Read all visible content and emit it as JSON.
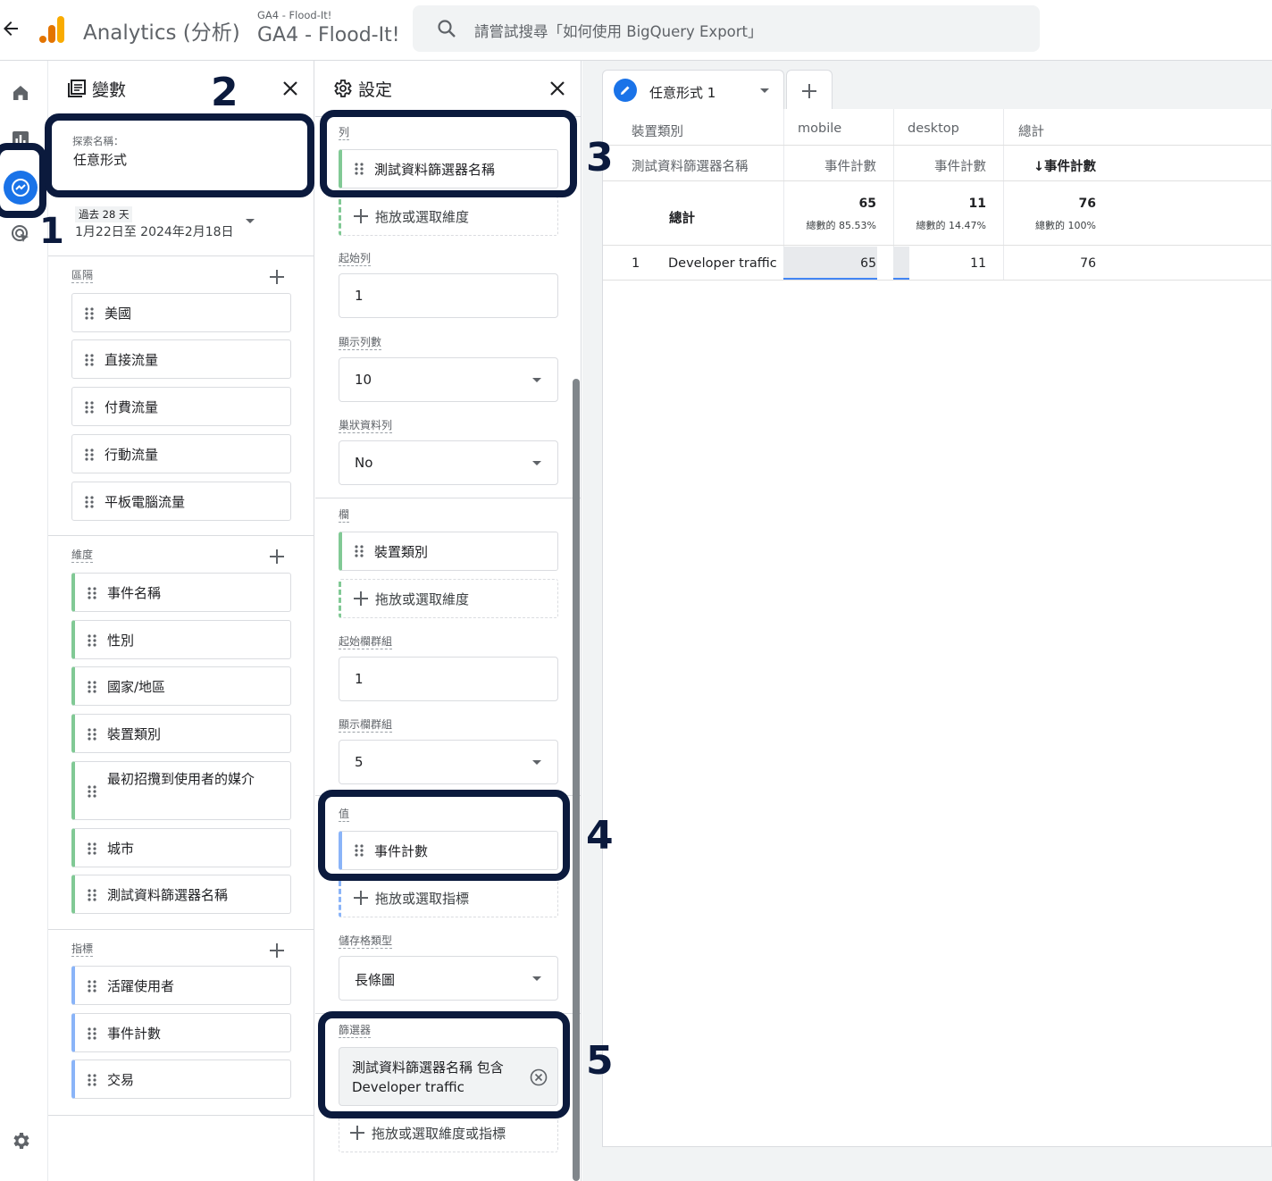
{
  "header": {
    "app_title": "Analytics (分析)",
    "property_small": "GA4 - Flood-It!",
    "property_name": "GA4 - Flood-It!",
    "search_placeholder": "請嘗試搜尋「如何使用 BigQuery Export」"
  },
  "rail": {
    "icons": [
      "home-icon",
      "reports-icon",
      "explore-icon",
      "advertising-icon",
      "settings-icon"
    ]
  },
  "variables": {
    "title": "變數",
    "exploration_name_label": "探索名稱：",
    "exploration_name": "任意形式",
    "date_preset": "過去 28 天",
    "date_range": "1月22日至 2024年2月18日",
    "segments_label": "區隔",
    "segments": [
      "美國",
      "直接流量",
      "付費流量",
      "行動流量",
      "平板電腦流量"
    ],
    "dimensions_label": "維度",
    "dimensions": [
      "事件名稱",
      "性別",
      "國家/地區",
      "裝置類別",
      "最初招攬到使用者的媒介",
      "城市",
      "測試資料篩選器名稱"
    ],
    "metrics_label": "指標",
    "metrics": [
      "活躍使用者",
      "事件計數",
      "交易"
    ]
  },
  "settings": {
    "title": "設定",
    "rows_label": "列",
    "rows_item": "測試資料篩選器名稱",
    "drop_dimension": "拖放或選取維度",
    "start_row_label": "起始列",
    "start_row": "1",
    "show_rows_label": "顯示列數",
    "show_rows": "10",
    "nested_rows_label": "巢狀資料列",
    "nested_rows": "No",
    "columns_label": "欄",
    "columns_item": "裝置類別",
    "drop_dimension_2": "拖放或選取維度",
    "start_col_group_label": "起始欄群組",
    "start_col_group": "1",
    "show_col_groups_label": "顯示欄群組",
    "show_col_groups": "5",
    "values_label": "值",
    "values_item": "事件計數",
    "drop_metric": "拖放或選取指標",
    "cell_type_label": "儲存格類型",
    "cell_type": "長條圖",
    "filters_label": "篩選器",
    "filter_text": "測試資料篩選器名稱 包含 Developer traffic",
    "drop_dim_or_metric": "拖放或選取維度或指標"
  },
  "canvas": {
    "tab_label": "任意形式 1",
    "table": {
      "col_dim_header": "裝置類別",
      "row_dim_header": "測試資料篩選器名稱",
      "columns": [
        "mobile",
        "desktop",
        "總計"
      ],
      "metric_headers": [
        "事件計數",
        "事件計數",
        "↓事件計數"
      ],
      "totals_label": "總計",
      "totals": [
        {
          "value": "65",
          "pct": "總數的 85.53%"
        },
        {
          "value": "11",
          "pct": "總數的 14.47%"
        },
        {
          "value": "76",
          "pct": "總數的 100%"
        }
      ],
      "rows": [
        {
          "index": "1",
          "name": "Developer traffic",
          "values": [
            "65",
            "11",
            "76"
          ],
          "bar_fraction": [
            0.855,
            0.145
          ]
        }
      ]
    }
  },
  "annotations": [
    "1",
    "2",
    "3",
    "4",
    "5"
  ]
}
